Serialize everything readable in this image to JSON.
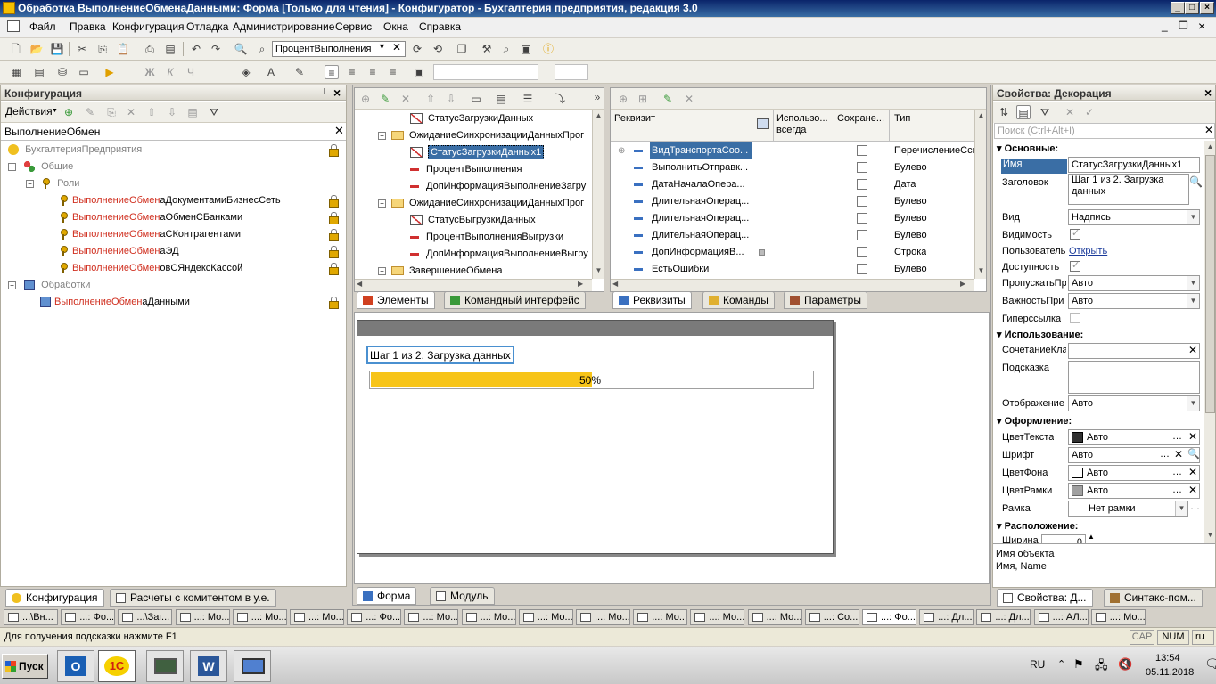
{
  "window": {
    "title": "Обработка ВыполнениеОбменаДанными: Форма [Только для чтения] - Конфигуратор - Бухгалтерия предприятия, редакция 3.0"
  },
  "menu": [
    "Файл",
    "Правка",
    "Конфигурация",
    "Отладка",
    "Администрирование",
    "Сервис",
    "Окна",
    "Справка"
  ],
  "toolbar": {
    "search_value": "ПроцентВыполнения"
  },
  "config_panel": {
    "title": "Конфигурация",
    "actions_label": "Действия",
    "search_value": "ВыполнениеОбмен",
    "tree": [
      {
        "label": "БухгалтерияПредприятия"
      },
      {
        "label": "Общие"
      },
      {
        "label": "Роли"
      },
      {
        "hl": "ВыполнениеОбмен",
        "rest": "аДокументамиБизнесСеть"
      },
      {
        "hl": "ВыполнениеОбмен",
        "rest": "аОбменСБанками"
      },
      {
        "hl": "ВыполнениеОбмен",
        "rest": "аСКонтрагентами"
      },
      {
        "hl": "ВыполнениеОбмен",
        "rest": "аЭД"
      },
      {
        "hl": "ВыполнениеОбмен",
        "rest": "овСЯндексКассой"
      },
      {
        "label": "Обработки"
      },
      {
        "hl": "ВыполнениеОбмен",
        "rest": "аДанными"
      }
    ],
    "tabs": [
      "Конфигурация",
      "Расчеты с комитентом в у.е."
    ]
  },
  "elements_tree": {
    "rows": [
      {
        "label": "СтатусЗагрузкиДанных",
        "kind": "decor"
      },
      {
        "label": "ОжиданиеСинхронизацииДанныхПрог",
        "kind": "folder"
      },
      {
        "label": "СтатусЗагрузкиДанных1",
        "kind": "decor"
      },
      {
        "label": "ПроцентВыполнения",
        "kind": "field"
      },
      {
        "label": "ДопИнформацияВыполнениеЗагру",
        "kind": "field"
      },
      {
        "label": "ОжиданиеСинхронизацииДанныхПрог",
        "kind": "folder"
      },
      {
        "label": "СтатусВыгрузкиДанных",
        "kind": "decor"
      },
      {
        "label": "ПроцентВыполненияВыгрузки",
        "kind": "field"
      },
      {
        "label": "ДопИнформацияВыполнениеВыгру",
        "kind": "field"
      },
      {
        "label": "ЗавершениеОбмена",
        "kind": "folder"
      }
    ],
    "tabs": [
      "Элементы",
      "Командный интерфейс"
    ]
  },
  "requisites": {
    "columns": [
      "Реквизит",
      "Использо... всегда",
      "Сохране...",
      "Тип"
    ],
    "rows": [
      {
        "name": "ВидТранспортаСоо...",
        "type": "ПеречислениеСсы"
      },
      {
        "name": "ВыполнитьОтправк...",
        "type": "Булево"
      },
      {
        "name": "ДатаНачалаОпера...",
        "type": "Дата"
      },
      {
        "name": "ДлительнаяОперац...",
        "type": "Булево"
      },
      {
        "name": "ДлительнаяОперац...",
        "type": "Булево"
      },
      {
        "name": "ДлительнаяОперац...",
        "type": "Булево"
      },
      {
        "name": "ДопИнформацияВ...",
        "type": "Строка"
      },
      {
        "name": "ЕстьОшибки",
        "type": "Булево"
      }
    ],
    "tabs": [
      "Реквизиты",
      "Команды",
      "Параметры"
    ]
  },
  "preview": {
    "step_label": "Шаг 1 из 2. Загрузка данных",
    "progress_text": "50%",
    "progress_value": 0.5,
    "tabs": [
      "Форма",
      "Модуль"
    ]
  },
  "properties": {
    "title": "Свойства: Декорация",
    "search_placeholder": "Поиск (Ctrl+Alt+I)",
    "sections": {
      "main": "Основные:",
      "usage": "Использование:",
      "design": "Оформление:",
      "layout": "Расположение:"
    },
    "labels": {
      "name": "Имя",
      "header": "Заголовок",
      "kind": "Вид",
      "visibility": "Видимость",
      "user": "Пользователь",
      "availability": "Доступность",
      "skip": "ПропускатьПр",
      "importance": "ВажностьПри",
      "hyperlink": "Гиперссылка",
      "shortcut": "СочетаниеКла",
      "tooltip": "Подсказка",
      "display": "Отображение",
      "text_color": "ЦветТекста",
      "font": "Шрифт",
      "bg_color": "ЦветФона",
      "border_color": "ЦветРамки",
      "frame": "Рамка",
      "width": "Ширина"
    },
    "values": {
      "name": "СтатусЗагрузкиДанных1",
      "header": "Шаг 1 из 2. Загрузка данных",
      "kind": "Надпись",
      "user_link": "Открыть",
      "skip": "Авто",
      "importance": "Авто",
      "display": "Авто",
      "text_color": "Авто",
      "font": "Авто",
      "bg_color": "Авто",
      "border_color": "Авто",
      "frame": "Нет рамки",
      "width": "0"
    },
    "description_line1": "Имя объекта",
    "description_line2": "Имя, Name",
    "tabs": [
      "Свойства: Д...",
      "Синтакс-пом..."
    ]
  },
  "windows_bar": [
    "...\\Вн...",
    "...: Фо...",
    "...\\Заг...",
    "...: Мо...",
    "...: Мо...",
    "...: Мо...",
    "...: Фо...",
    "...: Мо...",
    "...: Мо...",
    "...: Мо...",
    "...: Мо...",
    "...: Мо...",
    "...: Мо...",
    "...: Мо...",
    "...: Со...",
    "...: Фо...",
    "...: Дл...",
    "...: Дл...",
    "...: АЛ...",
    "...: Мо..."
  ],
  "status": {
    "hint": "Для получения подсказки нажмите F1",
    "cap": "CAP",
    "num": "NUM",
    "lang": "ru"
  },
  "taskbar": {
    "start": "Пуск",
    "lang": "RU",
    "time": "13:54",
    "date": "05.11.2018"
  }
}
